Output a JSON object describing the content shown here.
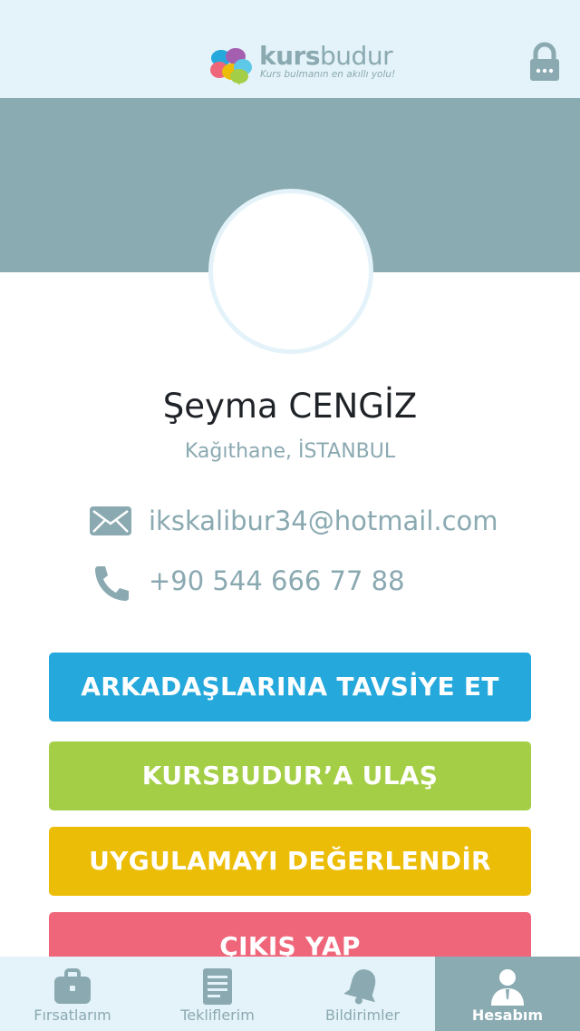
{
  "header": {
    "brand_bold": "kurs",
    "brand_light": "budur",
    "tagline": "Kurs bulmanın en akıllı yolu!",
    "lock_icon": "lock-icon"
  },
  "profile": {
    "name": "Şeyma CENGİZ",
    "location": "Kağıthane, İSTANBUL",
    "email": "ikskalibur34@hotmail.com",
    "phone": "+90 544 666 77 88"
  },
  "actions": {
    "share_label": "ARKADAŞLARINA TAVSİYE ET",
    "contact_label": "KURSBUDUR’A ULAŞ",
    "rate_label": "UYGULAMAYI DEĞERLENDİR",
    "logout_label": "ÇIKIŞ YAP"
  },
  "tabs": [
    {
      "label": "Fırsatlarım",
      "icon": "briefcase-icon",
      "active": false
    },
    {
      "label": "Tekliflerim",
      "icon": "document-icon",
      "active": false
    },
    {
      "label": "Bildirimler",
      "icon": "bell-icon",
      "active": false
    },
    {
      "label": "Hesabım",
      "icon": "user-icon",
      "active": true
    }
  ],
  "colors": {
    "header_bg": "#e4f3f9",
    "cover_bg": "#8aabb2",
    "muted_text": "#8aa9b1",
    "share": "#25a8dc",
    "contact": "#a4ce45",
    "rate": "#ecbd07",
    "logout": "#ef667b"
  }
}
